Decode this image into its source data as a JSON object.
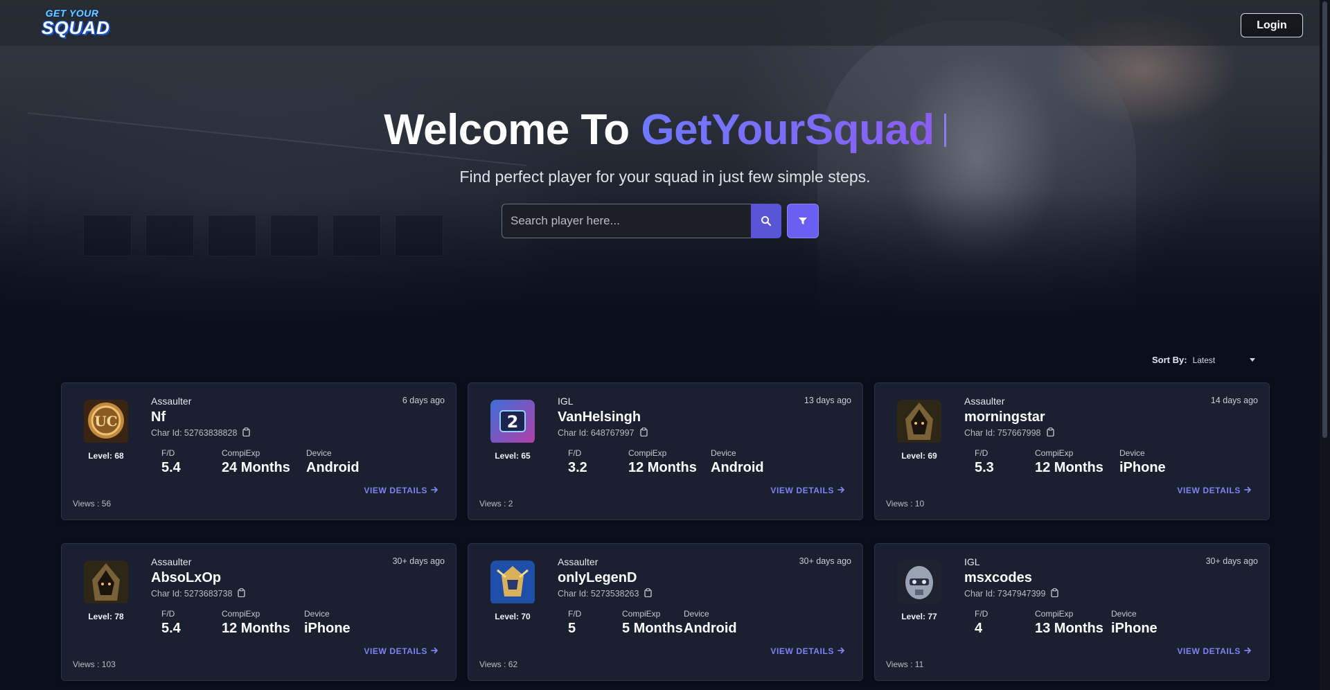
{
  "nav": {
    "logo_line1": "GET YOUR",
    "logo_line2": "SQUAD",
    "login_label": "Login"
  },
  "hero": {
    "title_prefix": "Welcome To",
    "title_accent": "GetYourSquad",
    "tagline": "Find perfect player for your squad in just few simple steps.",
    "search_placeholder": "Search player here...",
    "search_value": ""
  },
  "sort": {
    "label": "Sort By:",
    "value": "Latest"
  },
  "stat_labels": {
    "fd": "F/D",
    "exp": "CompiExp",
    "device": "Device"
  },
  "cards": [
    {
      "role": "Assaulter",
      "name": "Nf",
      "char_id": "Char Id: 52763838828",
      "time": "6 days ago",
      "level": "Level: 68",
      "fd": "5.4",
      "exp": "24 Months",
      "device": "Android",
      "views": "Views : 56",
      "details": "VIEW DETAILS",
      "avatar": "uc-coin-icon"
    },
    {
      "role": "IGL",
      "name": "VanHelsingh",
      "char_id": "Char Id: 648767997",
      "time": "13 days ago",
      "level": "Level: 65",
      "fd": "3.2",
      "exp": "12 Months",
      "device": "Android",
      "views": "Views : 2",
      "details": "VIEW DETAILS",
      "avatar": "gamepad-icon"
    },
    {
      "role": "Assaulter",
      "name": "morningstar",
      "char_id": "Char Id: 757667998",
      "time": "14 days ago",
      "level": "Level: 69",
      "fd": "5.3",
      "exp": "12 Months",
      "device": "iPhone",
      "views": "Views : 10",
      "details": "VIEW DETAILS",
      "avatar": "hooded-warrior-icon"
    },
    {
      "role": "Assaulter",
      "name": "AbsoLxOp",
      "char_id": "Char Id: 5273683738",
      "time": "30+ days ago",
      "level": "Level: 78",
      "fd": "5.4",
      "exp": "12 Months",
      "device": "iPhone",
      "views": "Views : 103",
      "details": "VIEW DETAILS",
      "avatar": "hooded-warrior-icon"
    },
    {
      "role": "Assaulter",
      "name": "onlyLegenD",
      "char_id": "Char Id: 5273538263",
      "time": "30+ days ago",
      "level": "Level: 70",
      "fd": "5",
      "exp": "5 Months",
      "device": "Android",
      "views": "Views : 62",
      "details": "VIEW DETAILS",
      "avatar": "golden-knight-icon"
    },
    {
      "role": "IGL",
      "name": "msxcodes",
      "char_id": "Char Id: 7347947399",
      "time": "30+ days ago",
      "level": "Level: 77",
      "fd": "4",
      "exp": "13 Months",
      "device": "iPhone",
      "views": "Views : 11",
      "details": "VIEW DETAILS",
      "avatar": "robot-helmet-icon"
    }
  ],
  "colors": {
    "accent": "#6a5ff0",
    "link": "#7d83f3",
    "card_bg": "#1a2030",
    "page_bg": "#0b0f1c"
  }
}
